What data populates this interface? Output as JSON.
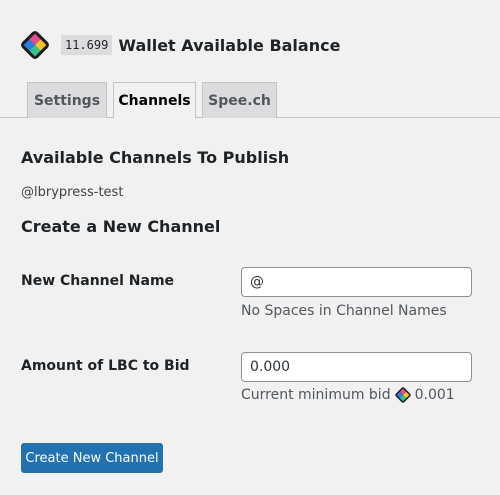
{
  "header": {
    "logo_icon": "lbry-logo-icon",
    "balance": "11.699",
    "title": "Wallet Available Balance"
  },
  "tabs": [
    {
      "label": "Settings",
      "active": false
    },
    {
      "label": "Channels",
      "active": true
    },
    {
      "label": "Spee.ch",
      "active": false
    }
  ],
  "channels": {
    "heading": "Available Channels To Publish",
    "items": [
      "@lbrypress-test"
    ]
  },
  "create": {
    "heading": "Create a New Channel",
    "name_label": "New Channel Name",
    "name_value": "@",
    "name_help": "No Spaces in Channel Names",
    "bid_label": "Amount of LBC to Bid",
    "bid_value": "0.000",
    "bid_help_prefix": "Current minimum bid",
    "bid_help_icon": "lbry-credits-icon",
    "bid_min": "0.001",
    "button_label": "Create New Channel"
  },
  "colors": {
    "accent": "#2271b1",
    "background": "#f1f1f1"
  }
}
